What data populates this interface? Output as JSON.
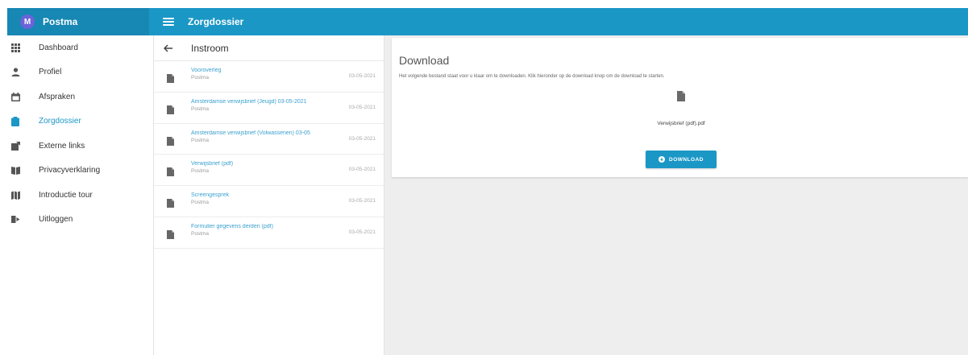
{
  "brand": {
    "avatar_letter": "M",
    "name": "Postma"
  },
  "header": {
    "title": "Zorgdossier"
  },
  "sidebar": {
    "items": [
      {
        "label": "Dashboard",
        "icon": "grid-icon"
      },
      {
        "label": "Profiel",
        "icon": "person-icon"
      },
      {
        "label": "Afspraken",
        "icon": "calendar-icon"
      },
      {
        "label": "Zorgdossier",
        "icon": "clipboard-icon",
        "active": true
      },
      {
        "label": "Externe links",
        "icon": "external-link-icon"
      },
      {
        "label": "Privacyverklaring",
        "icon": "privacy-icon"
      },
      {
        "label": "Introductie tour",
        "icon": "map-icon"
      },
      {
        "label": "Uitloggen",
        "icon": "logout-icon"
      }
    ]
  },
  "list": {
    "title": "Instroom",
    "items": [
      {
        "title": "Vooroverleg",
        "subtitle": "Postma",
        "date": "03-05-2021"
      },
      {
        "title": "Amsterdamse verwijsbrief (Jeugd) 03-05-2021",
        "subtitle": "Postma",
        "date": "03-05-2021"
      },
      {
        "title": "Amsterdamse verwijsbrief (Volwassenen) 03-05",
        "subtitle": "Postma",
        "date": "03-05-2021"
      },
      {
        "title": "Verwijsbrief (pdf)",
        "subtitle": "Postma",
        "date": "03-05-2021"
      },
      {
        "title": "Screengesprek",
        "subtitle": "Postma",
        "date": "03-05-2021"
      },
      {
        "title": "Formulier gegevens derden (pdf)",
        "subtitle": "Postma",
        "date": "03-05-2021"
      }
    ]
  },
  "download": {
    "title": "Download",
    "description": "Het volgende bestand staat voor u klaar om te downloaden. Klik hieronder op de download knop om de download te starten.",
    "file_name": "Verwijsbrief (pdf).pdf",
    "button_label": "DOWNLOAD"
  },
  "colors": {
    "primary": "#1b97c6",
    "brand_bar": "#1787b3",
    "avatar": "#6b63d9",
    "link": "#3aa0cf"
  }
}
